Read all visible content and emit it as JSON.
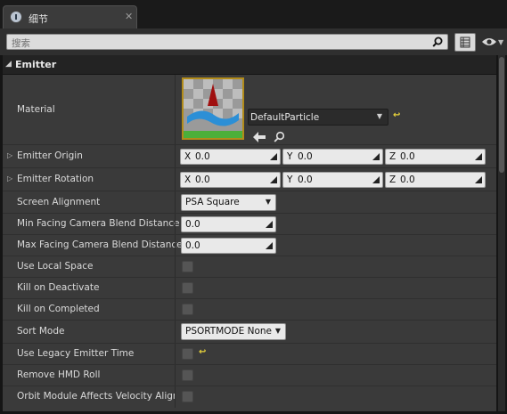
{
  "tab": {
    "title": "细节",
    "close": "✕",
    "icon": "details-icon"
  },
  "toolbar": {
    "search_placeholder": "搜索",
    "icons": [
      "search-icon",
      "property-matrix-icon",
      "eye-icon"
    ]
  },
  "category": {
    "title": "Emitter"
  },
  "rows": {
    "material": {
      "label": "Material",
      "value": "DefaultParticle"
    },
    "origin": {
      "label": "Emitter Origin",
      "x": "0.0",
      "y": "0.0",
      "z": "0.0"
    },
    "rotation": {
      "label": "Emitter Rotation",
      "x": "0.0",
      "y": "0.0",
      "z": "0.0"
    },
    "screen_alignment": {
      "label": "Screen Alignment",
      "value": "PSA Square"
    },
    "min_facing": {
      "label": "Min Facing Camera Blend Distance",
      "value": "0.0"
    },
    "max_facing": {
      "label": "Max Facing Camera Blend Distance",
      "value": "0.0"
    },
    "use_local_space": {
      "label": "Use Local Space",
      "checked": false
    },
    "kill_on_deactivate": {
      "label": "Kill on Deactivate",
      "checked": false
    },
    "kill_on_completed": {
      "label": "Kill on Completed",
      "checked": false
    },
    "sort_mode": {
      "label": "Sort Mode",
      "value": "PSORTMODE None"
    },
    "legacy_time": {
      "label": "Use Legacy Emitter Time",
      "checked": false
    },
    "remove_hmd_roll": {
      "label": "Remove HMD Roll",
      "checked": false
    },
    "orbit_module": {
      "label": "Orbit Module Affects Velocity Alignment",
      "checked": false
    }
  },
  "axes": {
    "x": "X",
    "y": "Y",
    "z": "Z"
  },
  "glyphs": {
    "expander": "▷",
    "collapse": "◢",
    "dropdown": "▼",
    "reset": "↩"
  },
  "colors": {
    "panel": "#3a3a3a",
    "header": "#232323",
    "field": "#e9e9e9",
    "reset": "#e8d33a",
    "thumb_border": "#b28c1a"
  }
}
